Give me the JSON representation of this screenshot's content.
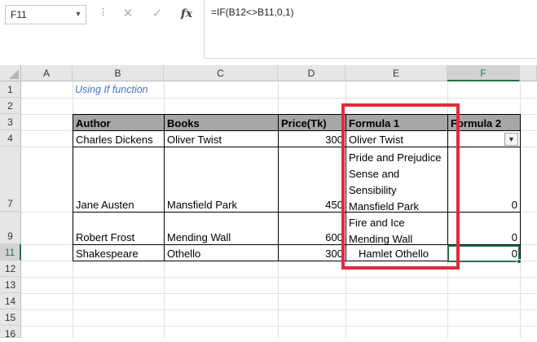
{
  "formula_bar": {
    "name_box": "F11",
    "fx_label": "fx",
    "formula": "=IF(B12<>B11,0,1)"
  },
  "columns": [
    "A",
    "B",
    "C",
    "D",
    "E",
    "F"
  ],
  "rows": [
    "1",
    "2",
    "3",
    "4",
    "7",
    "9",
    "11",
    "12",
    "13",
    "14",
    "15",
    "16"
  ],
  "sheet": {
    "note": "Using If function",
    "headers": {
      "author": "Author",
      "books": "Books",
      "price": "Price(Tk)",
      "formula1": "Formula 1",
      "formula2": "Formula 2"
    },
    "rows": [
      {
        "author": "Charles Dickens",
        "books": "Oliver Twist",
        "price": "300",
        "formula1": [
          "Oliver Twist"
        ],
        "formula2": ""
      },
      {
        "author": "Jane Austen",
        "books": "Mansfield Park",
        "price": "450",
        "formula1": [
          "Pride and Prejudice",
          "Sense and",
          "Sensibility",
          "Mansfield Park"
        ],
        "formula2": "0"
      },
      {
        "author": "Robert Frost",
        "books": "Mending Wall",
        "price": "600",
        "formula1": [
          "Fire and Ice",
          "Mending Wall"
        ],
        "formula2": "0"
      },
      {
        "author": "Shakespeare",
        "books": "Othello",
        "price": "300",
        "formula1": [
          "Hamlet Othello"
        ],
        "formula2": "0"
      }
    ]
  },
  "colors": {
    "highlight_box": "#e02b3a",
    "selection": "#217346",
    "note_text": "#4472c4",
    "header_fill": "#a6a6a6"
  },
  "icons": [
    "cancel-icon",
    "enter-icon",
    "fx-icon",
    "filter-icon",
    "dropdown-arrow-icon"
  ]
}
